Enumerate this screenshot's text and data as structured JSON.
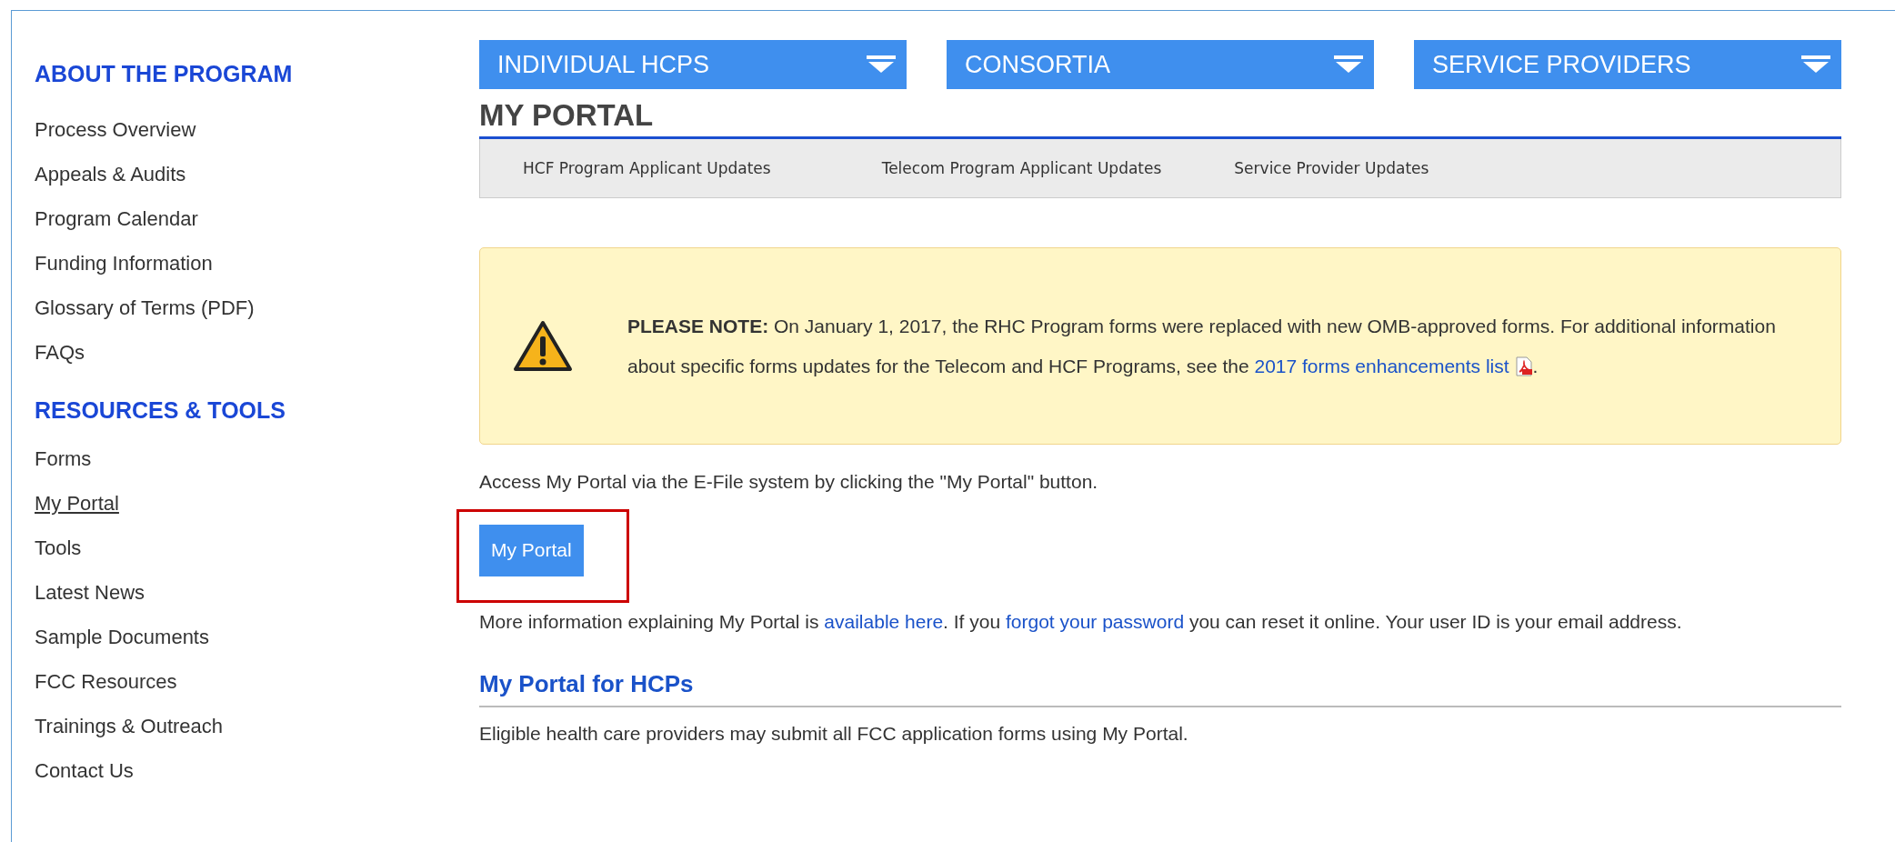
{
  "sidebar": {
    "sections": [
      {
        "heading": "ABOUT THE PROGRAM",
        "items": [
          {
            "label": "Process Overview",
            "selected": false
          },
          {
            "label": "Appeals & Audits",
            "selected": false
          },
          {
            "label": "Program Calendar",
            "selected": false
          },
          {
            "label": "Funding Information",
            "selected": false
          },
          {
            "label": "Glossary of Terms (PDF)",
            "selected": false
          },
          {
            "label": "FAQs",
            "selected": false
          }
        ]
      },
      {
        "heading": "RESOURCES & TOOLS",
        "items": [
          {
            "label": "Forms",
            "selected": false
          },
          {
            "label": "My Portal",
            "selected": true
          },
          {
            "label": "Tools",
            "selected": false
          },
          {
            "label": "Latest News",
            "selected": false
          },
          {
            "label": "Sample Documents",
            "selected": false
          },
          {
            "label": "FCC Resources",
            "selected": false
          },
          {
            "label": "Trainings & Outreach",
            "selected": false
          },
          {
            "label": "Contact Us",
            "selected": false
          }
        ]
      }
    ]
  },
  "menus": [
    {
      "label": "INDIVIDUAL HCPS"
    },
    {
      "label": "CONSORTIA"
    },
    {
      "label": "SERVICE PROVIDERS"
    }
  ],
  "page_title": "MY PORTAL",
  "subnav": [
    "HCF Program Applicant Updates",
    "Telecom Program Applicant Updates",
    "Service Provider Updates"
  ],
  "notice": {
    "segments": [
      {
        "kind": "text",
        "text": "**PLEASE NOTE:** On January 1, 2017, the RHC Program forms were replaced with new OMB-approved forms. For additional information about specific forms updates for the Telecom and HCF Programs, see the "
      },
      {
        "kind": "link",
        "text": "2017 forms enhancements list"
      },
      {
        "kind": "pdf"
      },
      {
        "kind": "text",
        "text": "."
      }
    ]
  },
  "intro": "Access My Portal via the E-File system by clicking the \"My Portal\" button.",
  "portal_button": {
    "label": "My Portal",
    "highlighted": true
  },
  "info": {
    "segments": [
      {
        "kind": "text",
        "text": "More information explaining My Portal is "
      },
      {
        "kind": "link",
        "text": "available here"
      },
      {
        "kind": "text",
        "text": ". If you "
      },
      {
        "kind": "link",
        "text": "forgot your password"
      },
      {
        "kind": "text",
        "text": " you can reset it online. Your user ID is your email address."
      }
    ]
  },
  "section": {
    "heading": "My Portal for HCPs",
    "text": "Eligible health care providers may submit all FCC application forms using My Portal."
  }
}
